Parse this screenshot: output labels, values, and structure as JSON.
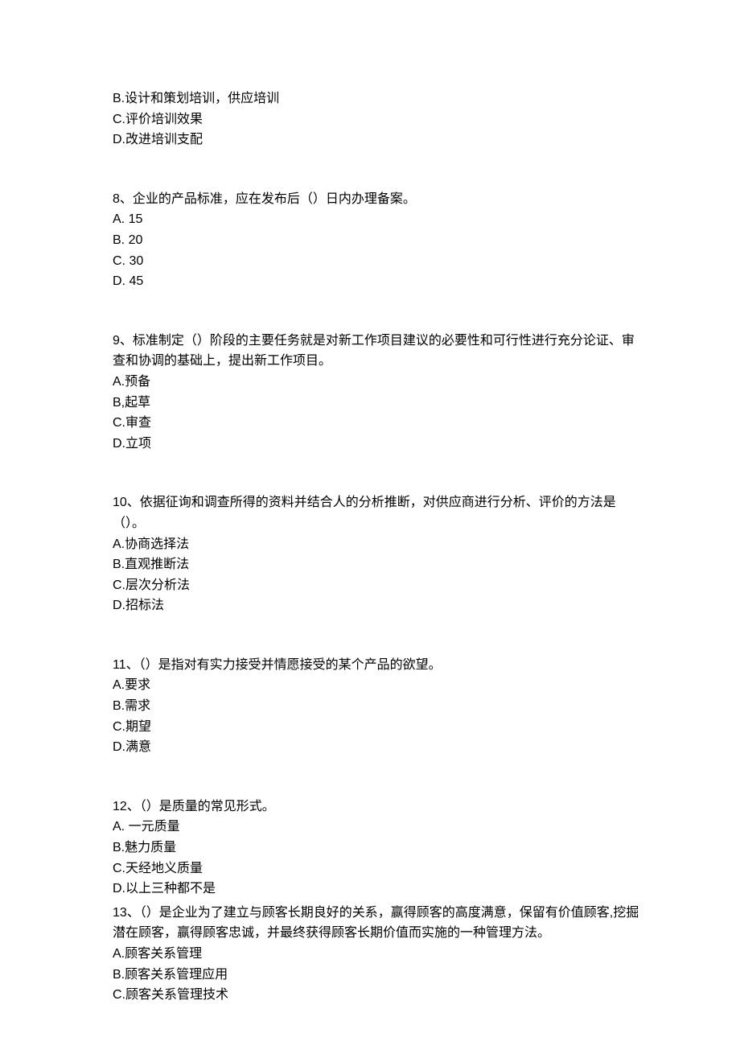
{
  "q7": {
    "options": {
      "B": "B.设计和策划培训，供应培训",
      "C": "C.评价培训效果",
      "D": "D.改进培训支配"
    }
  },
  "q8": {
    "text": "8、企业的产品标准，应在发布后（）日内办理备案。",
    "options": {
      "A": "A.   15",
      "B": "B.   20",
      "C": "C.   30",
      "D": "D.   45"
    }
  },
  "q9": {
    "text": "9、标准制定（）阶段的主要任务就是对新工作项目建议的必要性和可行性进行充分论证、审查和协调的基础上，提出新工作项目。",
    "options": {
      "A": "A.预备",
      "B": "B,起草",
      "C": "C.审查",
      "D": "D.立项"
    }
  },
  "q10": {
    "text": "10、依据征询和调查所得的资料并结合人的分析推断，对供应商进行分析、评价的方法是（）。",
    "options": {
      "A": "A.协商选择法",
      "B": "B.直观推断法",
      "C": "C.层次分析法",
      "D": "D.招标法"
    }
  },
  "q11": {
    "text": "11、（）是指对有实力接受并情愿接受的某个产品的欲望。",
    "options": {
      "A": "A.要求",
      "B": "B.需求",
      "C": "C.期望",
      "D": "D.满意"
    }
  },
  "q12": {
    "text": "12、（）是质量的常见形式。",
    "options": {
      "A": "A.   一元质量",
      "B": "B.魅力质量",
      "C": "C.天经地义质量",
      "D": "D.以上三种都不是"
    }
  },
  "q13": {
    "text": "13、（）是企业为了建立与顾客长期良好的关系，赢得顾客的高度满意，保留有价值顾客,挖掘潜在顾客，赢得顾客忠诚，并最终获得顾客长期价值而实施的一种管理方法。",
    "options": {
      "A": "A.顾客关系管理",
      "B": "B.顾客关系管理应用",
      "C": "C.顾客关系管理技术"
    }
  }
}
